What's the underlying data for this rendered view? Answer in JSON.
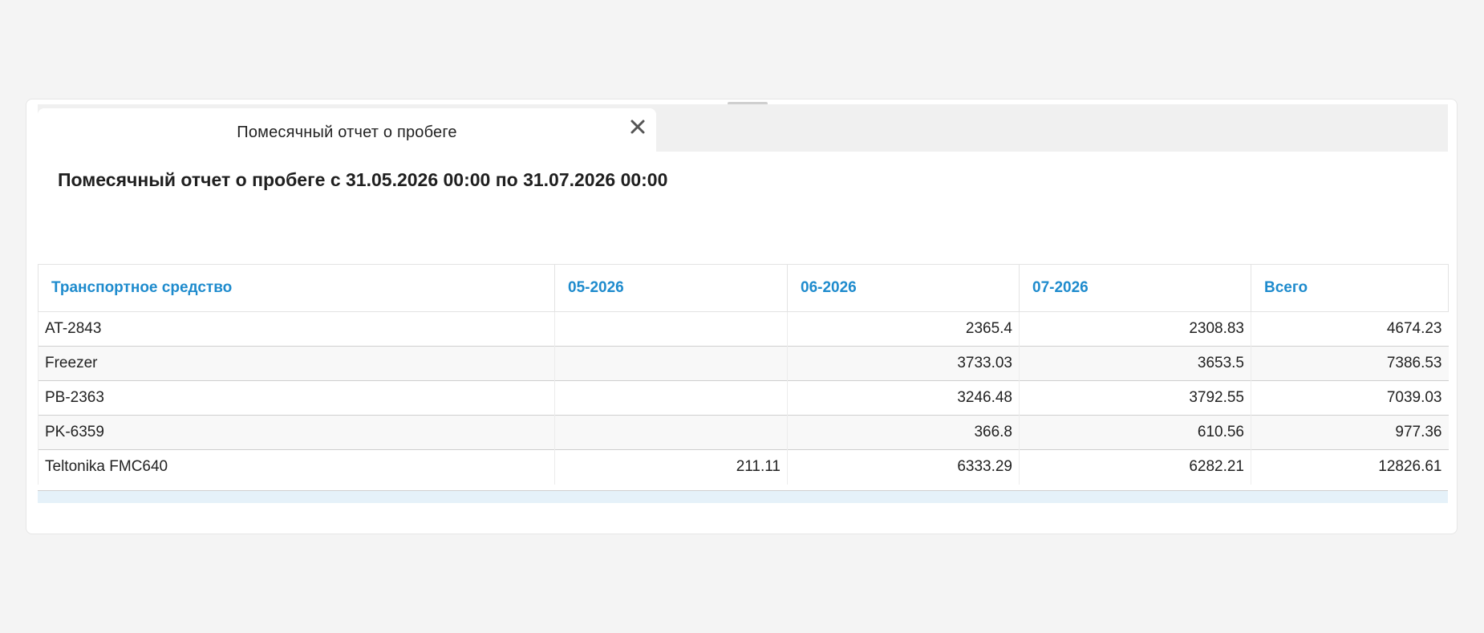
{
  "tab": {
    "label": "Помесячный отчет о пробеге",
    "close_glyph": "✕"
  },
  "report": {
    "title": "Помесячный отчет о пробеге с 31.05.2026 00:00 по 31.07.2026 00:00"
  },
  "table": {
    "columns": [
      "Транспортное средство",
      "05-2026",
      "06-2026",
      "07-2026",
      "Всего"
    ],
    "rows": [
      [
        "AT-2843",
        "",
        "2365.4",
        "2308.83",
        "4674.23"
      ],
      [
        "Freezer",
        "",
        "3733.03",
        "3653.5",
        "7386.53"
      ],
      [
        "PB-2363",
        "",
        "3246.48",
        "3792.55",
        "7039.03"
      ],
      [
        "PK-6359",
        "",
        "366.8",
        "610.56",
        "977.36"
      ],
      [
        "Teltonika FMC640",
        "211.11",
        "6333.29",
        "6282.21",
        "12826.61"
      ]
    ]
  },
  "colors": {
    "accent": "#1e8bcd",
    "background": "#f4f4f4",
    "footer_band": "#e5f1f9"
  },
  "icons": {
    "close": "close-icon"
  }
}
